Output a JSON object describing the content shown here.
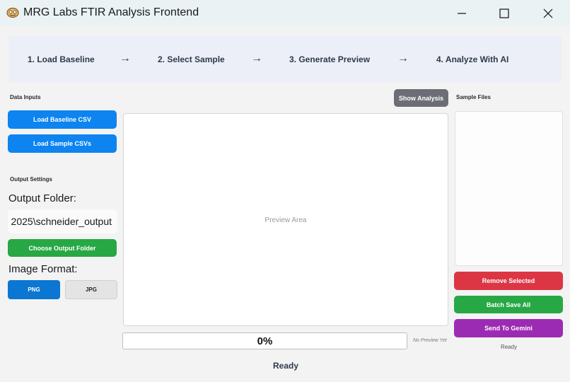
{
  "window": {
    "title": "MRG Labs FTIR Analysis Frontend"
  },
  "steps": [
    {
      "label": "1. Load Baseline"
    },
    {
      "label": "2. Select Sample"
    },
    {
      "label": "3. Generate Preview"
    },
    {
      "label": "4. Analyze With AI"
    }
  ],
  "step_arrow": "→",
  "left_panel": {
    "data_inputs_label": "Data Inputs",
    "load_baseline_label": "Load Baseline CSV",
    "load_sample_label": "Load Sample CSVs",
    "output_settings_label": "Output Settings",
    "output_folder_label": "Output Folder:",
    "output_folder_value": "2025\\schneider_output",
    "choose_folder_label": "Choose Output Folder",
    "image_format_label": "Image Format:",
    "formats": [
      "PNG",
      "JPG"
    ],
    "selected_format": "PNG"
  },
  "center": {
    "show_analysis_label": "Show Analysis",
    "preview_placeholder": "Preview Area",
    "progress_text": "0%",
    "progress_value": 0,
    "preview_status": "No Preview Yet"
  },
  "right_panel": {
    "sample_files_label": "Sample Files",
    "remove_selected_label": "Remove Selected",
    "batch_save_label": "Batch Save All",
    "send_gemini_label": "Send To Gemini",
    "status_text": "Ready"
  },
  "status_bar": {
    "text": "Ready"
  },
  "colors": {
    "blue": "#0d84f0",
    "green": "#27a844",
    "red": "#dc3645",
    "purple": "#9c2bb3",
    "gray": "#6b6f75"
  }
}
